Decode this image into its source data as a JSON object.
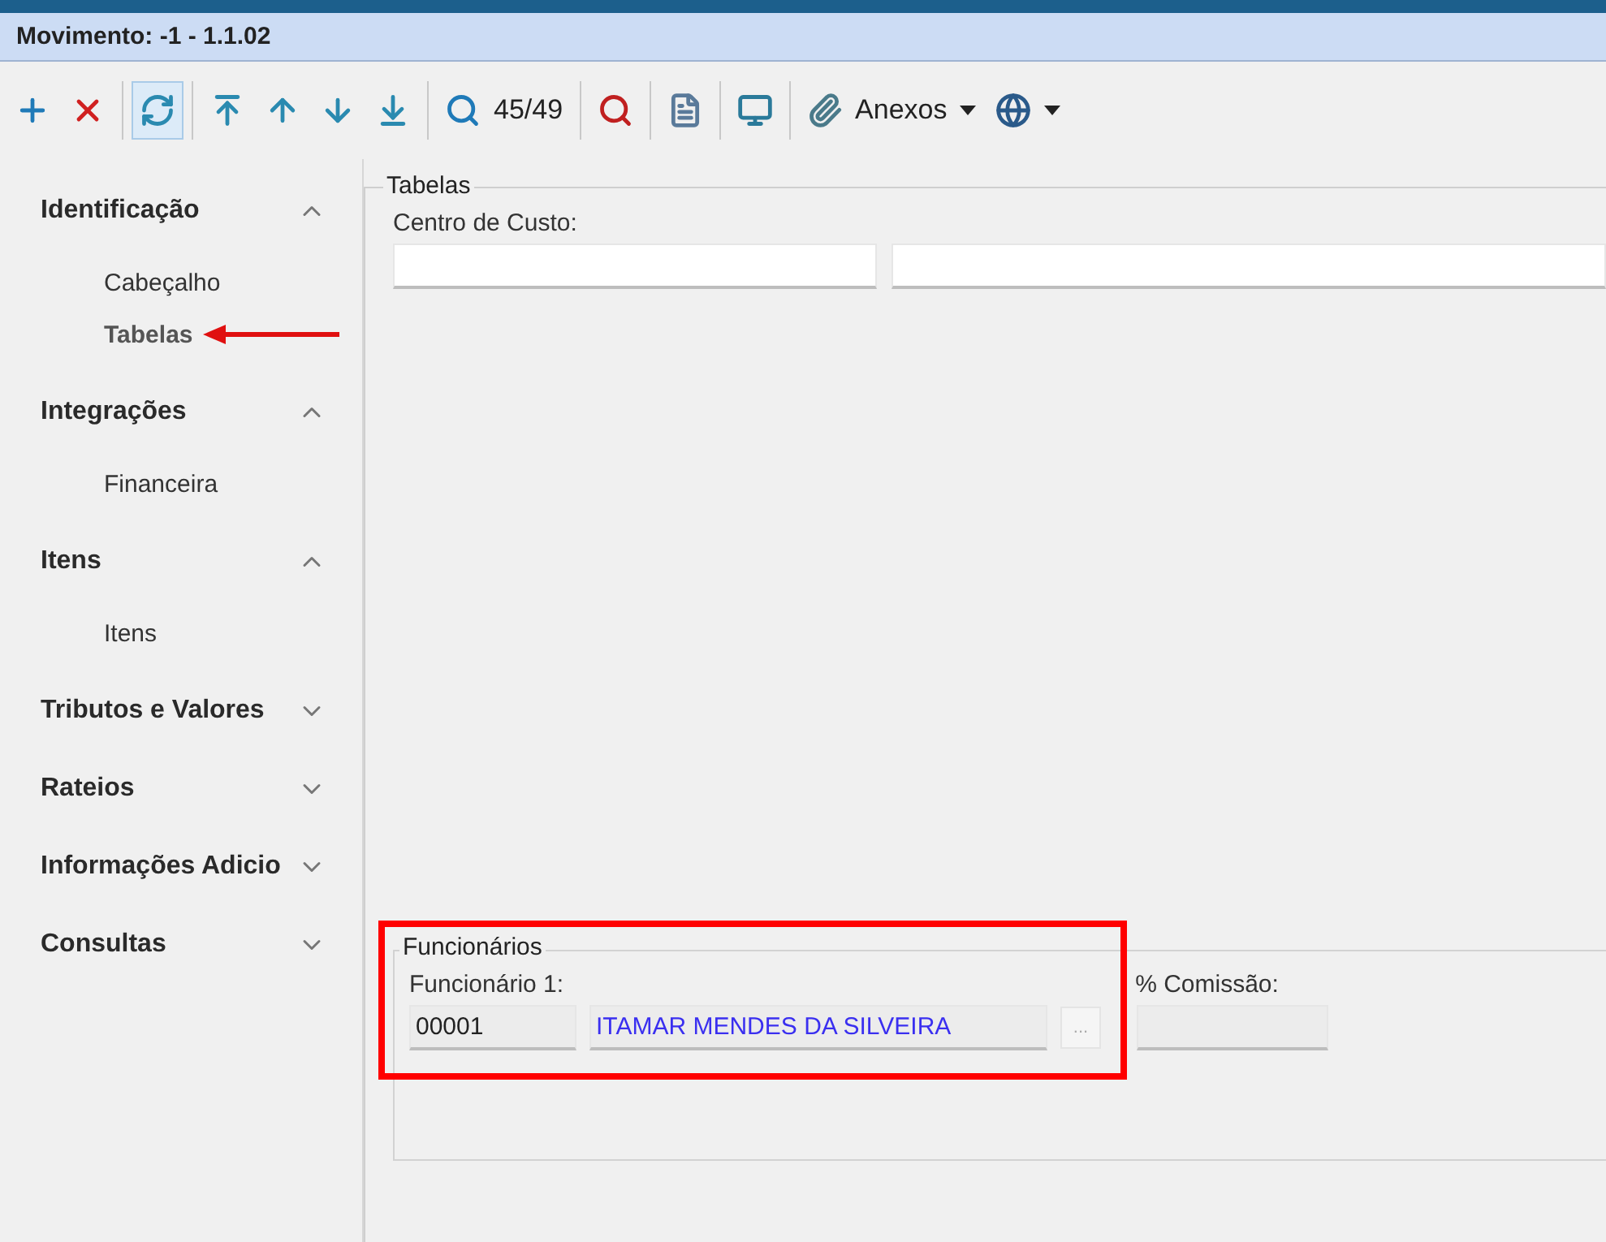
{
  "window": {
    "title": "Movimento: -1 - 1.1.02"
  },
  "toolbar": [
    {
      "kind": "add",
      "highlighted": false
    },
    {
      "kind": "delete",
      "highlighted": false
    },
    {
      "kind": "separator"
    },
    {
      "kind": "refresh",
      "highlighted": true
    },
    {
      "kind": "separator"
    },
    {
      "kind": "first",
      "highlighted": false
    },
    {
      "kind": "prev",
      "highlighted": false
    },
    {
      "kind": "next",
      "highlighted": false
    },
    {
      "kind": "last",
      "highlighted": false
    },
    {
      "kind": "separator"
    },
    {
      "kind": "search",
      "highlighted": false,
      "label": "45/49"
    },
    {
      "kind": "separator"
    },
    {
      "kind": "sql",
      "highlighted": false
    },
    {
      "kind": "separator"
    },
    {
      "kind": "report",
      "highlighted": false
    },
    {
      "kind": "separator"
    },
    {
      "kind": "monitor",
      "highlighted": false
    },
    {
      "kind": "separator"
    },
    {
      "kind": "attach",
      "highlighted": false,
      "label": "Anexos"
    },
    {
      "kind": "globe",
      "highlighted": false
    }
  ],
  "sidebar": {
    "sections": [
      {
        "label": "Identificação",
        "expanded": true,
        "children": [
          {
            "label": "Cabeçalho",
            "selected": false
          },
          {
            "label": "Tabelas",
            "selected": true
          }
        ]
      },
      {
        "label": "Integrações",
        "expanded": true,
        "children": [
          {
            "label": "Financeira",
            "selected": false
          }
        ]
      },
      {
        "label": "Itens",
        "expanded": true,
        "children": [
          {
            "label": "Itens",
            "selected": false
          }
        ]
      },
      {
        "label": "Tributos e Valores",
        "expanded": false
      },
      {
        "label": "Rateios",
        "expanded": false
      },
      {
        "label": "Informações Adicio",
        "expanded": false
      },
      {
        "label": "Consultas",
        "expanded": false
      }
    ]
  },
  "panel": {
    "title": "Tabelas",
    "cost_center": {
      "label": "Centro de Custo:"
    },
    "employees": {
      "title": "Funcionários",
      "label": "Funcionário 1:",
      "code": "00001",
      "name": "ITAMAR MENDES DA SILVEIRA",
      "lookup": "...",
      "commission_label": "% Comissão:"
    }
  }
}
